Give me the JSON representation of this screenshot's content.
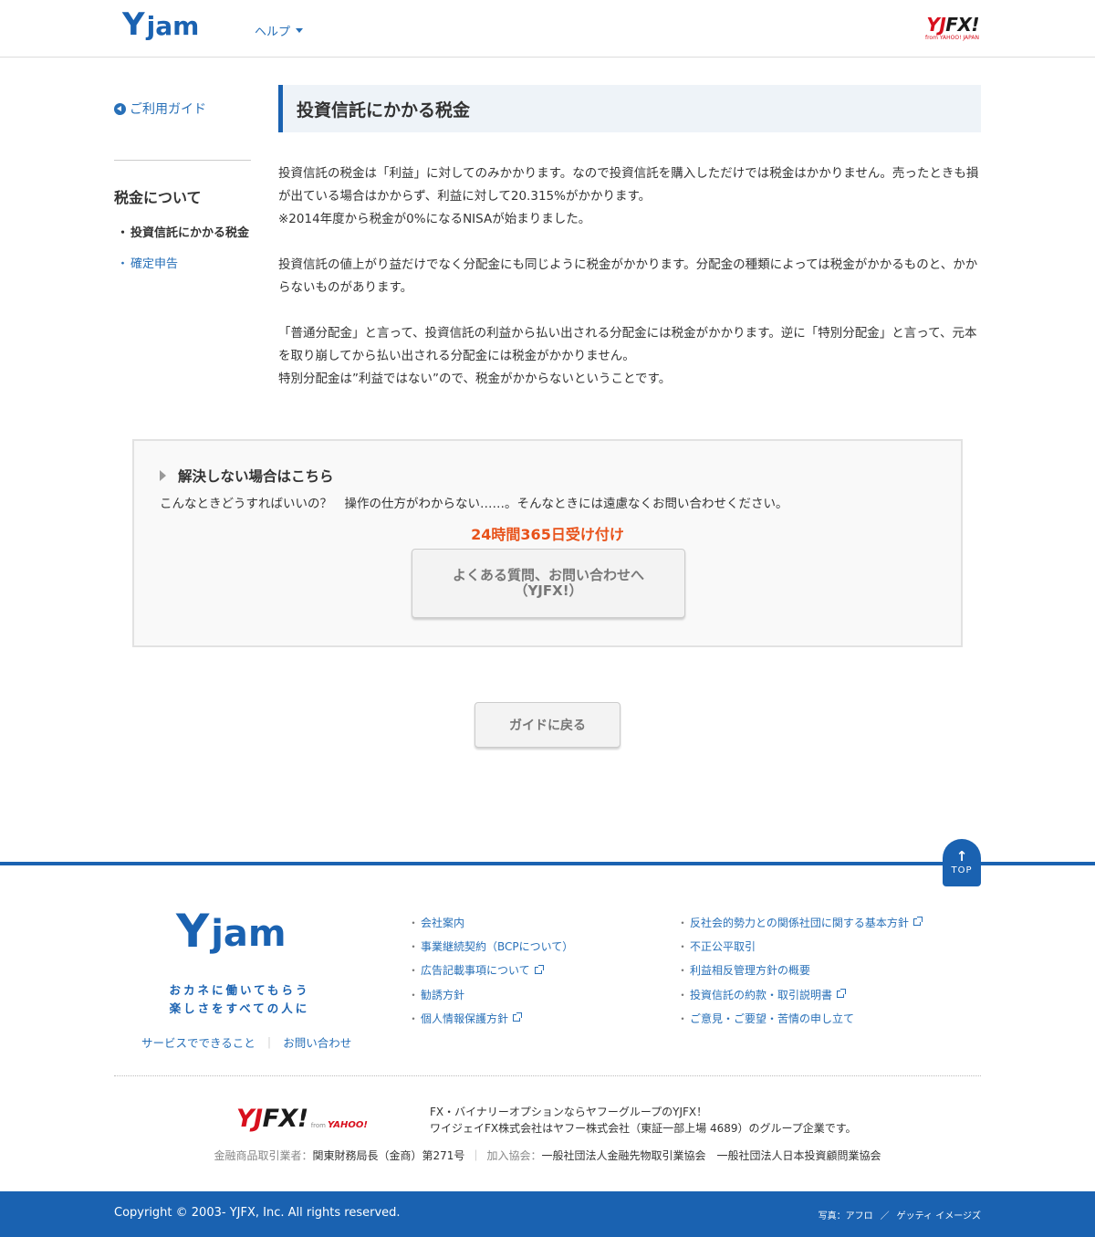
{
  "header": {
    "logo_y": "Y",
    "logo_rest": "jam",
    "help_label": "ヘルプ",
    "brand_yj": "YJ",
    "brand_fx": "FX!",
    "brand_sub": "from YAHOO! JAPAN"
  },
  "sidebar": {
    "guide_link": "ご利用ガイド",
    "heading": "税金について",
    "items": [
      {
        "bullet": "・",
        "label": "投資信託にかかる税金"
      },
      {
        "bullet": "・",
        "label": "確定申告"
      }
    ]
  },
  "main": {
    "title": "投資信託にかかる税金",
    "paragraphs": [
      [
        "投資信託の税金は「利益」に対してのみかかります。なので投資信託を購入しただけでは税金はかかりません。売ったときも損が出ている場合はかからず、利益に対して20.315%がかかります。",
        "※2014年度から税金が0%になるNISAが始まりました。"
      ],
      [
        "投資信託の値上がり益だけでなく分配金にも同じように税金がかかります。分配金の種類によっては税金がかかるものと、かからないものがあります。"
      ],
      [
        "「普通分配金」と言って、投資信託の利益から払い出される分配金には税金がかかります。逆に「特別分配金」と言って、元本を取り崩してから払い出される分配金には税金がかかりません。",
        "特別分配金は”利益ではない”ので、税金がかからないということです。"
      ]
    ]
  },
  "help_box": {
    "heading": "解決しない場合はこちら",
    "description": "こんなときどうすればいいの？　操作の仕方がわからない……。そんなときには遠慮なくお問い合わせください。",
    "hours": "24時間365日受け付け",
    "button_line1": "よくある質問、お問い合わせへ",
    "button_line2": "（YJFX!）"
  },
  "back_button": "ガイドに戻る",
  "footer": {
    "top_label": "TOP",
    "logo_y": "Y",
    "logo_rest": "jam",
    "tagline_1": "おカネに働いてもらう",
    "tagline_2": "楽しさをすべての人に",
    "sublink_1": "サービスでできること",
    "sublink_sep": "｜",
    "sublink_2": "お問い合わせ",
    "col1": [
      {
        "label": "会社案内",
        "external": false
      },
      {
        "label": "事業継続契約（BCPについて）",
        "external": false
      },
      {
        "label": "広告記載事項について",
        "external": true
      },
      {
        "label": "勧誘方針",
        "external": false
      },
      {
        "label": "個人情報保護方針",
        "external": true
      }
    ],
    "col2": [
      {
        "label": "反社会的勢力との関係社団に関する基本方針",
        "external": true
      },
      {
        "label": "不正公平取引",
        "external": false
      },
      {
        "label": "利益相反管理方針の概要",
        "external": false
      },
      {
        "label": "投資信託の約款・取引説明書",
        "external": true
      },
      {
        "label": "ご意見・ご要望・苦情の申し立て",
        "external": false
      }
    ],
    "brand_yj": "YJ",
    "brand_fx": "FX!",
    "brand_from": "from",
    "brand_yahoo": "YAHOO!",
    "desc_1": "FX・バイナリーオプションならヤフーグループのYJFX！",
    "desc_2": "ワイジェイFX株式会社はヤフー株式会社（東証一部上場 4689）のグループ企業です。",
    "reg_key_1": "金融商品取引業者：",
    "reg_val_1": "関東財務局長（金商）第271号",
    "reg_sep": "｜",
    "reg_key_2": "加入協会：",
    "reg_val_2": "一般社団法人金融先物取引業協会　一般社団法人日本投資顧問業協会",
    "copyright": "Copyright © 2003- YJFX, Inc. All rights reserved.",
    "photo_1": "写真：アフロ",
    "photo_sep": "／",
    "photo_2": "ゲッティ イメージズ"
  },
  "colors": {
    "brand_blue": "#1a62b1",
    "link_blue": "#2870b8",
    "accent_orange": "#e8521a",
    "brand_red": "#d8101e"
  }
}
